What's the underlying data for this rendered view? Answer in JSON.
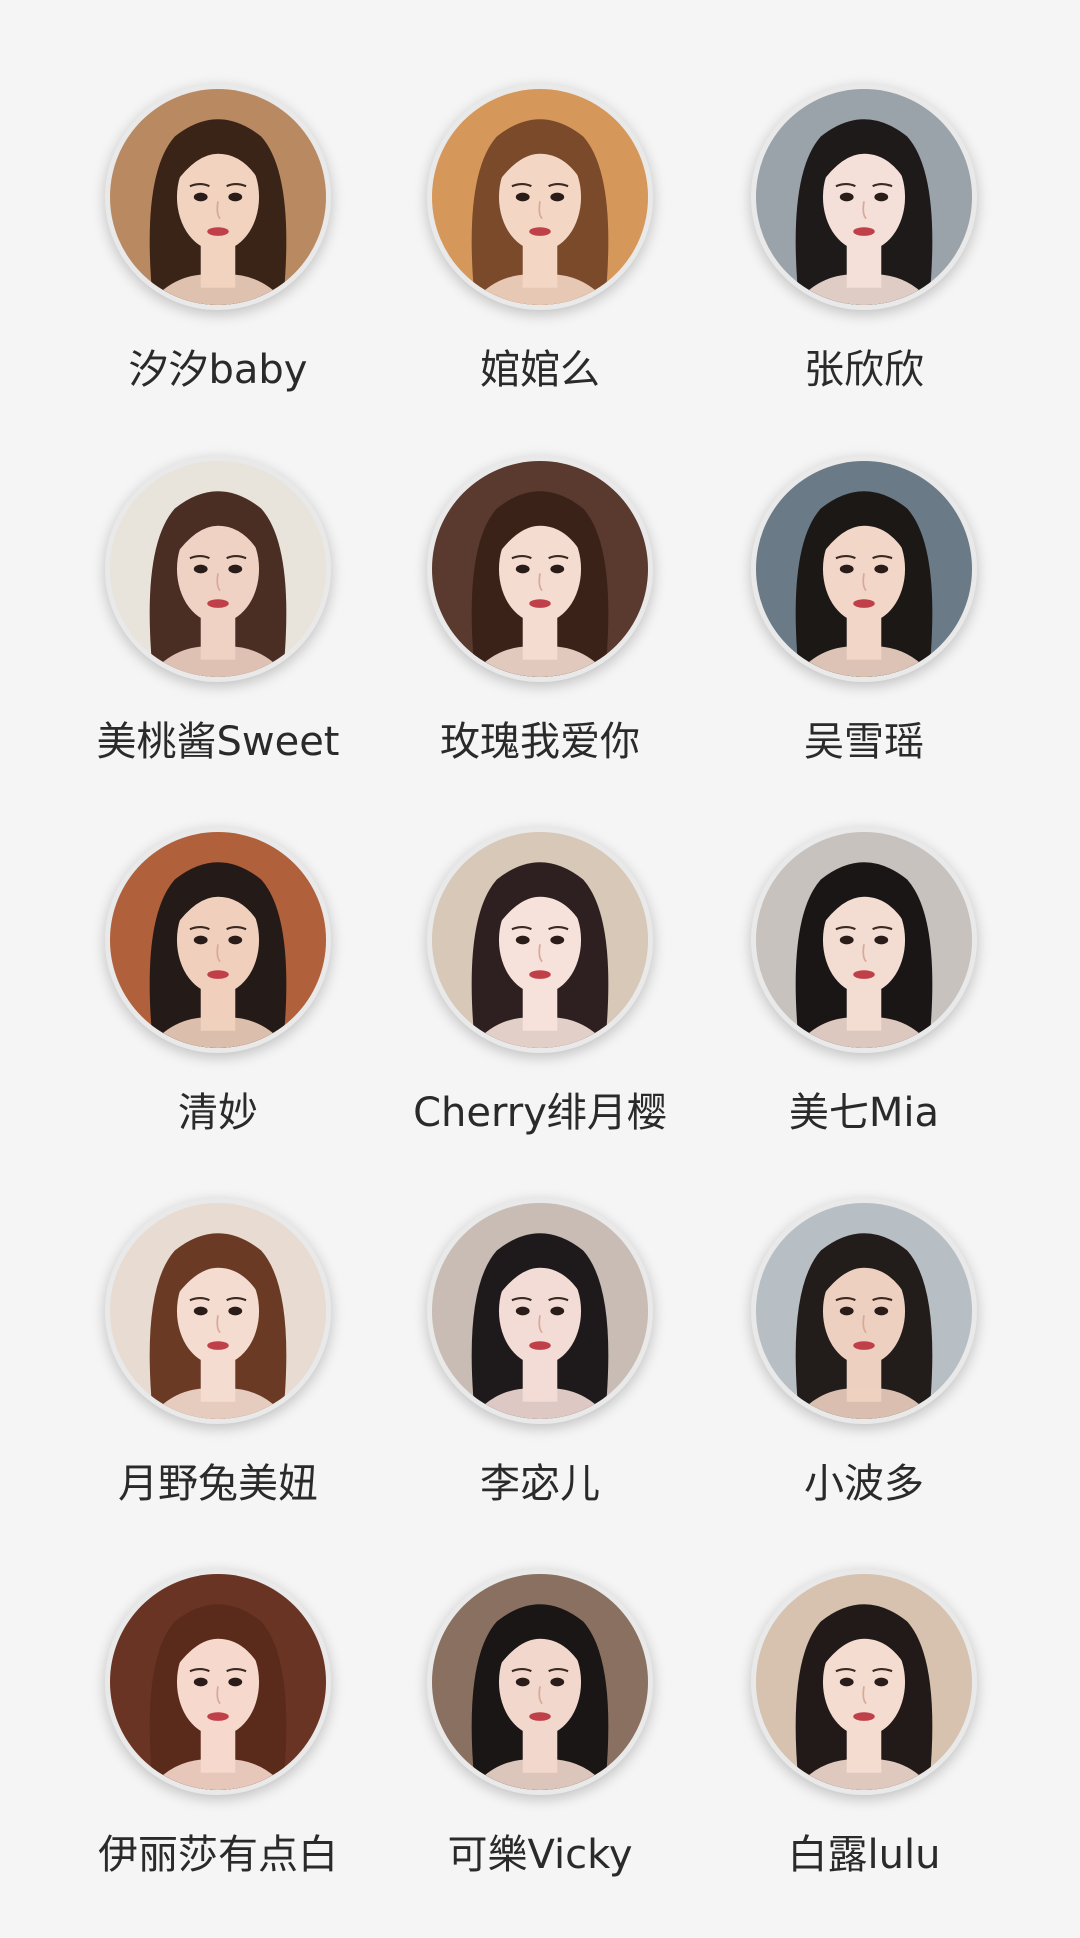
{
  "profiles": [
    {
      "name": "汐汐baby",
      "bg": "#b98a62",
      "hair": "#3a2418",
      "skin": "#f1d3c0"
    },
    {
      "name": "婠婠么",
      "bg": "#d6985a",
      "hair": "#7a4a2a",
      "skin": "#f3d6c4"
    },
    {
      "name": "张欣欣",
      "bg": "#9aa3aa",
      "hair": "#1e1a1a",
      "skin": "#f4e0d8"
    },
    {
      "name": "美桃酱Sweet",
      "bg": "#e8e4dc",
      "hair": "#4a2e24",
      "skin": "#f0d2c4"
    },
    {
      "name": "玫瑰我爱你",
      "bg": "#5a3a2e",
      "hair": "#3a2218",
      "skin": "#f5dcd0"
    },
    {
      "name": "吴雪瑶",
      "bg": "#6a7a86",
      "hair": "#1c1816",
      "skin": "#f2d6c8"
    },
    {
      "name": "清妙",
      "bg": "#b0603a",
      "hair": "#241a18",
      "skin": "#f0d0bc"
    },
    {
      "name": "Cherry绯月樱",
      "bg": "#d8c8b8",
      "hair": "#2e2020",
      "skin": "#f6e2da"
    },
    {
      "name": "美七Mia",
      "bg": "#c8c2be",
      "hair": "#1a1616",
      "skin": "#f3dcd2"
    },
    {
      "name": "月野兔美妞",
      "bg": "#e8dcd2",
      "hair": "#6a3a24",
      "skin": "#f4dcd0"
    },
    {
      "name": "李宓儿",
      "bg": "#c8bcb4",
      "hair": "#1e1a1c",
      "skin": "#f3dcd6"
    },
    {
      "name": "小波多",
      "bg": "#b8bfc4",
      "hair": "#221c1a",
      "skin": "#eed0c0"
    },
    {
      "name": "伊丽莎有点白",
      "bg": "#6a3424",
      "hair": "#5a2a1a",
      "skin": "#f6d8cc"
    },
    {
      "name": "可樂Vicky",
      "bg": "#8a7060",
      "hair": "#1a1616",
      "skin": "#f2d8cc"
    },
    {
      "name": "白露lulu",
      "bg": "#d6c2ae",
      "hair": "#221a18",
      "skin": "#f4dcd0"
    }
  ]
}
